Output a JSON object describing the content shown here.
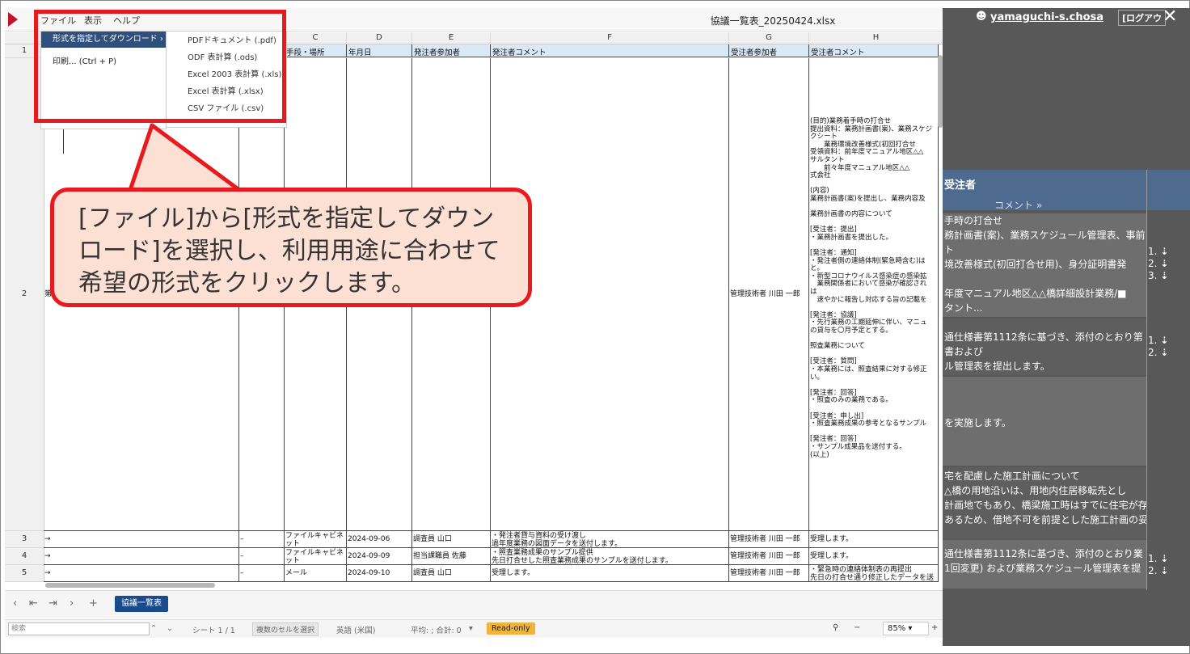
{
  "window": {
    "title": "協議一覧表_20250424.xlsx",
    "menus": [
      "ファイル",
      "表示",
      "ヘルプ"
    ]
  },
  "file_menu": {
    "items": [
      "形式を指定してダウンロード ›",
      "印刷... (Ctrl + P)"
    ],
    "submenu": [
      "PDFドキュメント (.pdf)",
      "ODF 表計算 (.ods)",
      "Excel 2003 表計算 (.xls)",
      "Excel 表計算 (.xlsx)",
      "CSV ファイル (.csv)"
    ]
  },
  "columns": [
    "C",
    "D",
    "E",
    "F",
    "G",
    "H"
  ],
  "header_row": [
    "手段・場所",
    "年月日",
    "発注者参加者",
    "発注者コメント",
    "受注者参加者",
    "受注者コメント"
  ],
  "row_numbers": [
    "1",
    "2",
    "3",
    "4",
    "5"
  ],
  "rows": {
    "row2": {
      "a": "第",
      "g": "管理技術者 川田 一郎",
      "h": "(目的)業務着手時の打合せ\n提出資料：業務計画書(案)、業務スケジ\nクシート\n　　業務環境改善様式(初回打合せ\n受領資料：前年度マニュアル地区△△\nサルタント\n　　前々年度マニュアル地区△△\n式会社\n\n(内容)\n業務計画書(案)を提出し、業務内容及\n\n業務計画書の内容について\n\n[受注者：提出]\n・業務計画書を提出した。\n\n[発注者：通知]\n・発注者側の連絡体制(緊急時含む)は\nと。\n・新型コロナウイルス感染症の感染拡\n　業務関係者において感染が確認され\nは\n　速やかに報告し対応する旨の記載を\n\n[発注者：協議]\n・先行業務の工期延伸に伴い、マニュ\nの貸与を〇月予定とする。\n\n照査業務について\n\n[受注者：質問]\n・本業務には、照査結果に対する修正\nい。\n\n[発注者：回答]\n・照査のみの業務である。\n\n[受注者：申し出]\n・照査業務成果の参考となるサンプル\n\n[発注者：回答]\n・サンプル成果品を送付する。\n(以上)"
    },
    "row3": {
      "a": "→",
      "b": "–",
      "c": "ファイルキャビネ\nット",
      "d": "2024-09-06",
      "e": "調査員 山口",
      "f": "・発注者貸与資料の受け渡し\n過年度業務の図面データを送付します。",
      "g": "管理技術者 川田 一郎",
      "h": "受理します。"
    },
    "row4": {
      "a": "→",
      "b": "–",
      "c": "ファイルキャビネ\nット",
      "d": "2024-09-09",
      "e": "担当課職員 佐藤",
      "f": "・照査業務成果のサンプル提供\n先日打合せした照査業務成果のサンプルを送付します。",
      "g": "管理技術者 川田 一郎",
      "h": "受理します。"
    },
    "row5": {
      "a": "→",
      "b": "–",
      "c": "メール",
      "d": "2024-09-10",
      "e": "調査員 山口",
      "f": "受理します。",
      "g": "管理技術者 川田 一郎",
      "h": "・緊急時の連絡体制表の再提出\n先日の打合せ通り修正したデータを送"
    }
  },
  "sheet_tab": "協議一覧表",
  "statusbar": {
    "search_placeholder": "検索",
    "sheet_count": "シート 1 / 1",
    "select_multiple": "複数のセルを選択",
    "language": "英語 (米国)",
    "sum": "平均: ; 合計: 0",
    "readonly": "Read-only",
    "zoom": "85%"
  },
  "callout": {
    "text": "[ファイル]から[形式を指定してダウンロード]を選択し、利用用途に合わせて希望の形式をクリックします。"
  },
  "right_panel": {
    "user": "yamaguchi-s.chosa",
    "logout": "[ログアウ",
    "section_title": "受注者",
    "comment_label": "コメント »",
    "blocks": [
      {
        "lines": [
          "手時の打合せ",
          "務計画書(案)、業務スケジュール管理表、事前",
          "ト",
          "境改善様式(初回打合せ用)、身分証明書発",
          "",
          "年度マニュアル地区△△橋詳細設計業務/■",
          "タント..."
        ],
        "nums": [
          "1.",
          "2.",
          "3."
        ]
      },
      {
        "lines": [
          "通仕様書第1112条に基づき、添付のとおり第",
          "書および",
          "ル管理表を提出します。"
        ],
        "nums": [
          "1.",
          "2."
        ]
      },
      {
        "lines": [
          "を実施します。"
        ],
        "nums": []
      },
      {
        "lines": [
          "宅を配慮した施工計画について",
          "△橋の用地沿いは、用地内住居移転先とし",
          "計画地でもあり、橋梁施工時はすでに住宅が存",
          "あるため、借地不可を前提とした施工計画の妥"
        ],
        "nums": []
      },
      {
        "lines": [
          "通仕様書第1112条に基づき、添付のとおり業",
          "1回変更) および業務スケジュール管理表を提"
        ],
        "nums": [
          "1.",
          "2."
        ]
      }
    ]
  },
  "colors": {
    "accent_red": "#e8191f",
    "callout_bg": "#fde0d4",
    "menu_active": "#2f4f7d",
    "panel_bg": "#585858"
  }
}
